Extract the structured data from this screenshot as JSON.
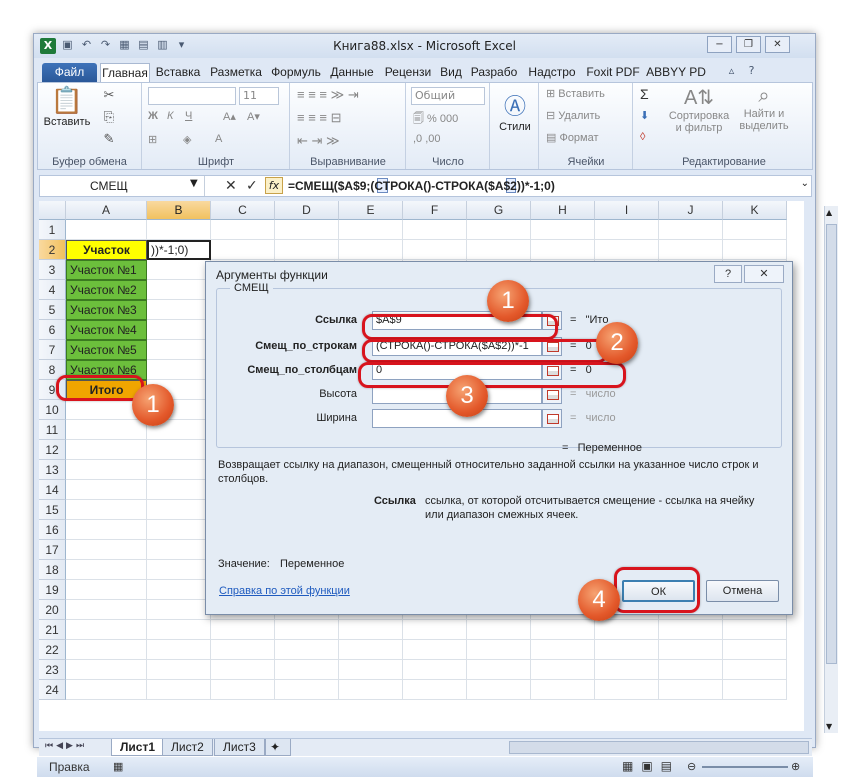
{
  "window": {
    "title": "Книга88.xlsx - Microsoft Excel",
    "controls": [
      "−",
      "❐",
      "✕"
    ]
  },
  "ribbon_tabs": [
    "Файл",
    "Главная",
    "Вставка",
    "Разметка",
    "Формуль",
    "Данные",
    "Рецензи",
    "Вид",
    "Разрабо",
    "Надстро",
    "Foxit PDF",
    "ABBYY PD"
  ],
  "ribbon": {
    "clipboard": {
      "paste": "Вставить",
      "label": "Буфер обмена"
    },
    "font": {
      "size": "11",
      "label": "Шрифт"
    },
    "alignment": {
      "label": "Выравнивание"
    },
    "number": {
      "format": "Общий",
      "label": "Число"
    },
    "styles": {
      "button": "Стили"
    },
    "cells": {
      "insert": "Вставить",
      "delete": "Удалить",
      "format": "Формат",
      "label": "Ячейки"
    },
    "editing": {
      "sort": "Сортировка и фильтр",
      "find": "Найти и выделить",
      "label": "Редактирование"
    }
  },
  "formula_bar": {
    "name_box": "СМЕЩ",
    "fx": "fx",
    "formula": "=СМЕЩ($A$9;(СТРОКА()-СТРОКА($A$2))*-1;0)"
  },
  "columns": [
    "A",
    "B",
    "C",
    "D",
    "E",
    "F",
    "G",
    "H",
    "I",
    "J",
    "K"
  ],
  "rows": [
    "1",
    "2",
    "3",
    "4",
    "5",
    "6",
    "7",
    "8",
    "9",
    "10",
    "11",
    "12",
    "13",
    "14",
    "15",
    "16",
    "17",
    "18",
    "19",
    "20",
    "21",
    "22",
    "23",
    "24"
  ],
  "cells": {
    "a2": "Участок",
    "b2": "))*-1;0)",
    "a3": "Участок №1",
    "a4": "Участок №2",
    "a5": "Участок №3",
    "a6": "Участок №4",
    "a7": "Участок №5",
    "a8": "Участок №6",
    "a9": "Итого"
  },
  "sheet_tabs": [
    "Лист1",
    "Лист2",
    "Лист3"
  ],
  "status": {
    "mode": "Правка"
  },
  "dialog": {
    "title": "Аргументы функции",
    "function_name": "СМЕЩ",
    "args": [
      {
        "label": "Ссылка",
        "value": "$A$9",
        "result": "\"Ито"
      },
      {
        "label": "Смещ_по_строкам",
        "value": "(СТРОКА()-СТРОКА($A$2))*-1",
        "result": "0"
      },
      {
        "label": "Смещ_по_столбцам",
        "value": "0",
        "result": "0"
      },
      {
        "label": "Высота",
        "value": "",
        "result": "число"
      },
      {
        "label": "Ширина",
        "value": "",
        "result": "число"
      }
    ],
    "equals": "=",
    "overall_result": "Переменное",
    "description": "Возвращает ссылку на диапазон, смещенный относительно заданной ссылки на указанное число строк и столбцов.",
    "arg_help_name": "Ссылка",
    "arg_help_text": "ссылка, от которой отсчитывается смещение - ссылка на ячейку или диапазон смежных ячеек.",
    "value_label": "Значение:",
    "value": "Переменное",
    "help_link": "Справка по этой функции",
    "ok": "ОК",
    "cancel": "Отмена",
    "help_btn": "?",
    "close_btn": "✕"
  },
  "callouts": [
    "1",
    "1",
    "2",
    "3",
    "4"
  ],
  "colors": {
    "highlight": "#d8141d",
    "badge": "#e3582a",
    "green_cells": "#6cbf3c",
    "header_yellow": "#ffff00",
    "total_orange": "#f0a500"
  }
}
